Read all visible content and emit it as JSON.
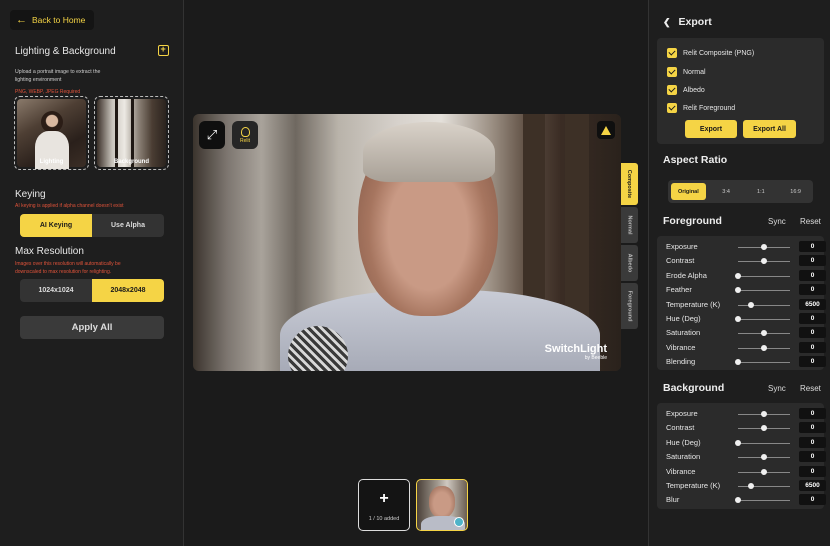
{
  "left": {
    "back_label": "Back to Home",
    "lighting_title": "Lighting & Background",
    "lighting_desc": "Upload a portrait image to extract the lighting environment",
    "format_note": "PNG, WEBP, JPEG Required",
    "thumb_lighting": "Lighting",
    "thumb_background": "Background",
    "keying_title": "Keying",
    "keying_note": "AI keying is applied if alpha channel doesn't exist",
    "keying_options": [
      "AI Keying",
      "Use Alpha"
    ],
    "keying_selected": "AI Keying",
    "maxres_title": "Max Resolution",
    "maxres_note": "Images over this resolution will automatically be downscaled to max resolution for relighting.",
    "maxres_options": [
      "1024x1024",
      "2048x2048"
    ],
    "maxres_selected": "2048x2048",
    "apply_label": "Apply All"
  },
  "viewer": {
    "relit_label": "Relit",
    "watermark_main": "SwitchLight",
    "watermark_sub": "by Beeble",
    "tabs": [
      "Composite",
      "Normal",
      "Albedo",
      "Foreground"
    ],
    "active_tab": "Composite",
    "add_count": "1 / 10 added"
  },
  "export": {
    "title": "Export",
    "items": [
      {
        "label": "Relit Composite (PNG)",
        "checked": true
      },
      {
        "label": "Normal",
        "checked": true
      },
      {
        "label": "Albedo",
        "checked": true
      },
      {
        "label": "Relit Foreground",
        "checked": true
      }
    ],
    "export_label": "Export",
    "export_all_label": "Export All"
  },
  "aspect": {
    "title": "Aspect Ratio",
    "options": [
      "Original",
      "3:4",
      "1:1",
      "16:9"
    ],
    "selected": "Original"
  },
  "foreground": {
    "title": "Foreground",
    "sync": "Sync",
    "reset": "Reset",
    "sliders": [
      {
        "label": "Exposure",
        "value": "0",
        "level": 0.5
      },
      {
        "label": "Contrast",
        "value": "0",
        "level": 0.5
      },
      {
        "label": "Erode Alpha",
        "value": "0",
        "level": 0.0
      },
      {
        "label": "Feather",
        "value": "0",
        "level": 0.0
      },
      {
        "label": "Temperature (K)",
        "value": "6500",
        "level": 0.25
      },
      {
        "label": "Hue (Deg)",
        "value": "0",
        "level": 0.0
      },
      {
        "label": "Saturation",
        "value": "0",
        "level": 0.5
      },
      {
        "label": "Vibrance",
        "value": "0",
        "level": 0.5
      },
      {
        "label": "Blending",
        "value": "0",
        "level": 0.0
      }
    ]
  },
  "background": {
    "title": "Background",
    "sync": "Sync",
    "reset": "Reset",
    "sliders": [
      {
        "label": "Exposure",
        "value": "0",
        "level": 0.5
      },
      {
        "label": "Contrast",
        "value": "0",
        "level": 0.5
      },
      {
        "label": "Hue (Deg)",
        "value": "0",
        "level": 0.0
      },
      {
        "label": "Saturation",
        "value": "0",
        "level": 0.5
      },
      {
        "label": "Vibrance",
        "value": "0",
        "level": 0.5
      },
      {
        "label": "Temperature (K)",
        "value": "6500",
        "level": 0.25
      },
      {
        "label": "Blur",
        "value": "0",
        "level": 0.0
      }
    ]
  },
  "colors": {
    "accent": "#f5d445",
    "panel": "#1e1e1e",
    "warning": "#e0533a"
  }
}
